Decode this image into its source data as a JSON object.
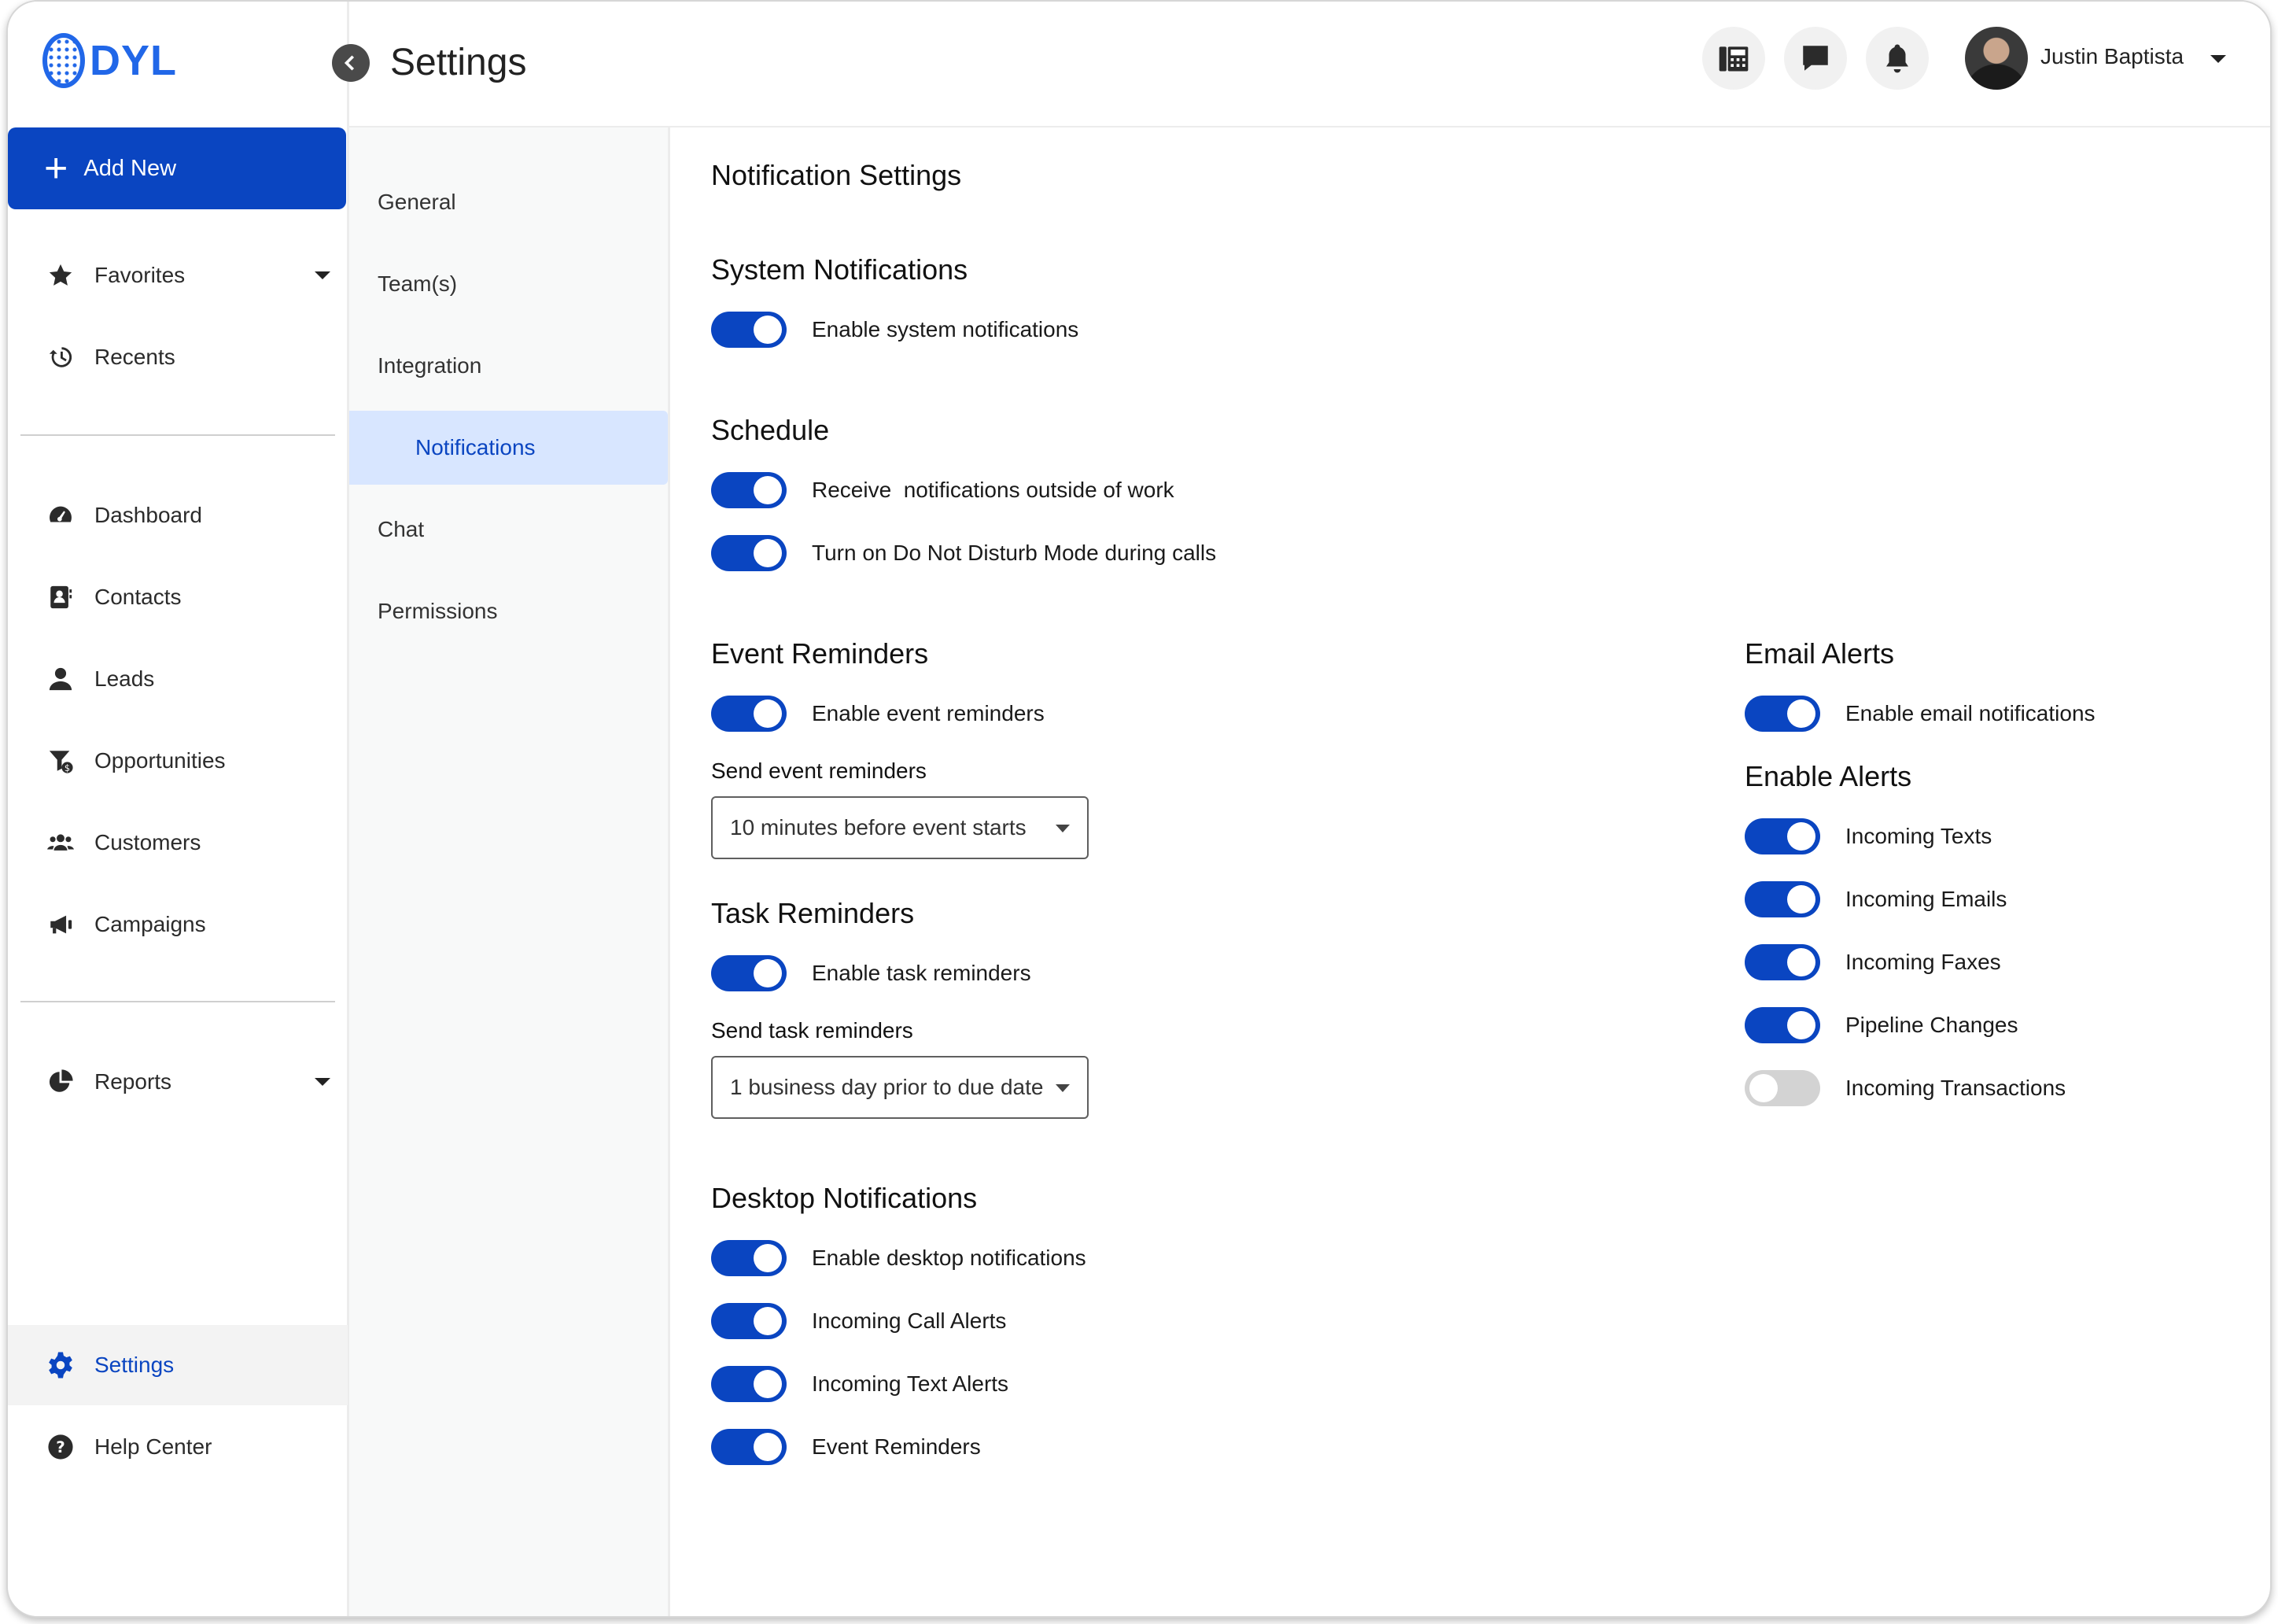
{
  "brand": {
    "logo_text": "DYL",
    "accent": "#0a45c1",
    "logo_color": "#2167e8"
  },
  "sidebar": {
    "add_new_label": "Add New",
    "favorites": "Favorites",
    "recents": "Recents",
    "items": [
      {
        "label": "Dashboard",
        "icon": "dashboard-icon"
      },
      {
        "label": "Contacts",
        "icon": "contacts-icon"
      },
      {
        "label": "Leads",
        "icon": "person-icon"
      },
      {
        "label": "Opportunities",
        "icon": "funnel-dollar-icon"
      },
      {
        "label": "Customers",
        "icon": "users-icon"
      },
      {
        "label": "Campaigns",
        "icon": "megaphone-icon"
      }
    ],
    "reports": "Reports",
    "settings": "Settings",
    "help_center": "Help Center"
  },
  "header": {
    "title": "Settings",
    "user_name": "Justin Baptista",
    "icons": [
      "fax-icon",
      "chat-icon",
      "bell-icon"
    ]
  },
  "subnav": {
    "items": [
      "General",
      "Team(s)",
      "Integration",
      "Notifications",
      "Chat",
      "Permissions"
    ],
    "active": "Notifications"
  },
  "content": {
    "title": "Notification Settings",
    "system": {
      "heading": "System Notifications",
      "enable_label": "Enable system notifications",
      "enabled": true
    },
    "schedule": {
      "heading": "Schedule",
      "outside_work_label": "Receive  notifications outside of work",
      "dnd_label": "Turn on Do Not Disturb Mode during calls"
    },
    "event_reminders": {
      "heading": "Event Reminders",
      "enable_label": "Enable event reminders",
      "send_label": "Send event reminders",
      "send_value": "10 minutes before event starts"
    },
    "task_reminders": {
      "heading": "Task Reminders",
      "enable_label": "Enable task reminders",
      "send_label": "Send task reminders",
      "send_value": "1 business day prior to due date"
    },
    "desktop": {
      "heading": "Desktop Notifications",
      "enable_label": "Enable desktop notifications",
      "call_label": "Incoming Call Alerts",
      "text_label": "Incoming Text Alerts",
      "event_label": "Event Reminders"
    },
    "email_alerts": {
      "heading": "Email Alerts",
      "enable_label": "Enable email notifications"
    },
    "enable_alerts": {
      "heading": "Enable Alerts",
      "texts": "Incoming Texts",
      "emails": "Incoming Emails",
      "faxes": "Incoming Faxes",
      "pipeline": "Pipeline Changes",
      "transactions": "Incoming Transactions",
      "transactions_enabled": false
    }
  }
}
